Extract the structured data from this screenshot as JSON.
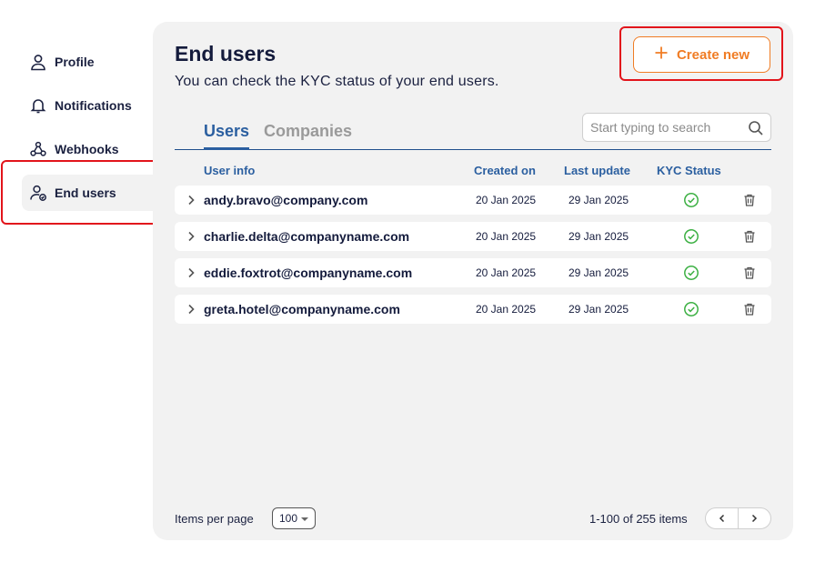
{
  "sidebar": {
    "items": [
      {
        "label": "Profile",
        "icon": "user-icon"
      },
      {
        "label": "Notifications",
        "icon": "bell-icon"
      },
      {
        "label": "Webhooks",
        "icon": "webhook-icon"
      },
      {
        "label": "End users",
        "icon": "user-check-icon",
        "active": true
      }
    ]
  },
  "page": {
    "title": "End users",
    "subtitle": "You can check the KYC status of your end users.",
    "create_label": "Create new"
  },
  "tabs": [
    {
      "label": "Users",
      "active": true
    },
    {
      "label": "Companies",
      "active": false
    }
  ],
  "search": {
    "placeholder": "Start typing to search"
  },
  "table": {
    "headers": {
      "user_info": "User info",
      "created_on": "Created on",
      "last_update": "Last update",
      "kyc_status": "KYC Status"
    },
    "rows": [
      {
        "email": "andy.bravo@company.com",
        "created": "20 Jan 2025",
        "updated": "29 Jan 2025",
        "kyc": "verified"
      },
      {
        "email": "charlie.delta@companyname.com",
        "created": "20 Jan 2025",
        "updated": "29 Jan 2025",
        "kyc": "verified"
      },
      {
        "email": "eddie.foxtrot@companyname.com",
        "created": "20 Jan 2025",
        "updated": "29 Jan 2025",
        "kyc": "verified"
      },
      {
        "email": "greta.hotel@companyname.com",
        "created": "20 Jan 2025",
        "updated": "29 Jan 2025",
        "kyc": "verified"
      }
    ]
  },
  "footer": {
    "items_per_page_label": "Items per page",
    "items_per_page_value": "100",
    "range_text": "1-100 of 255 items"
  },
  "colors": {
    "accent": "#f07c24",
    "primary": "#2b5fa0",
    "highlight": "#e2141b",
    "success": "#3cb043"
  }
}
